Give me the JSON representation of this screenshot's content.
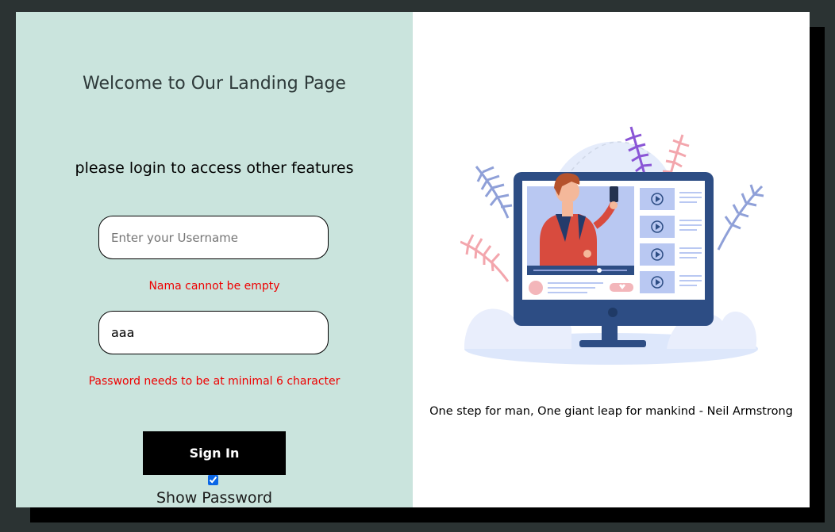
{
  "login": {
    "welcome": "Welcome to Our Landing Page",
    "subtitle": "please login to access other features",
    "username_placeholder": "Enter your Username",
    "username_error": "Nama cannot be empty",
    "password_value": "aaa",
    "password_error": "Password needs to be at minimal 6 character",
    "sign_in_label": "Sign In",
    "show_password_label": "Show Password",
    "show_password_checked": true
  },
  "illustration": {
    "quote": "One step for man, One giant leap for mankind - Neil Armstrong",
    "icon": "video-monitor-illustration"
  },
  "colors": {
    "left_panel_bg": "#cae4dd",
    "error": "#ee0000",
    "button_bg": "#000000",
    "page_bg": "#2b3333"
  }
}
